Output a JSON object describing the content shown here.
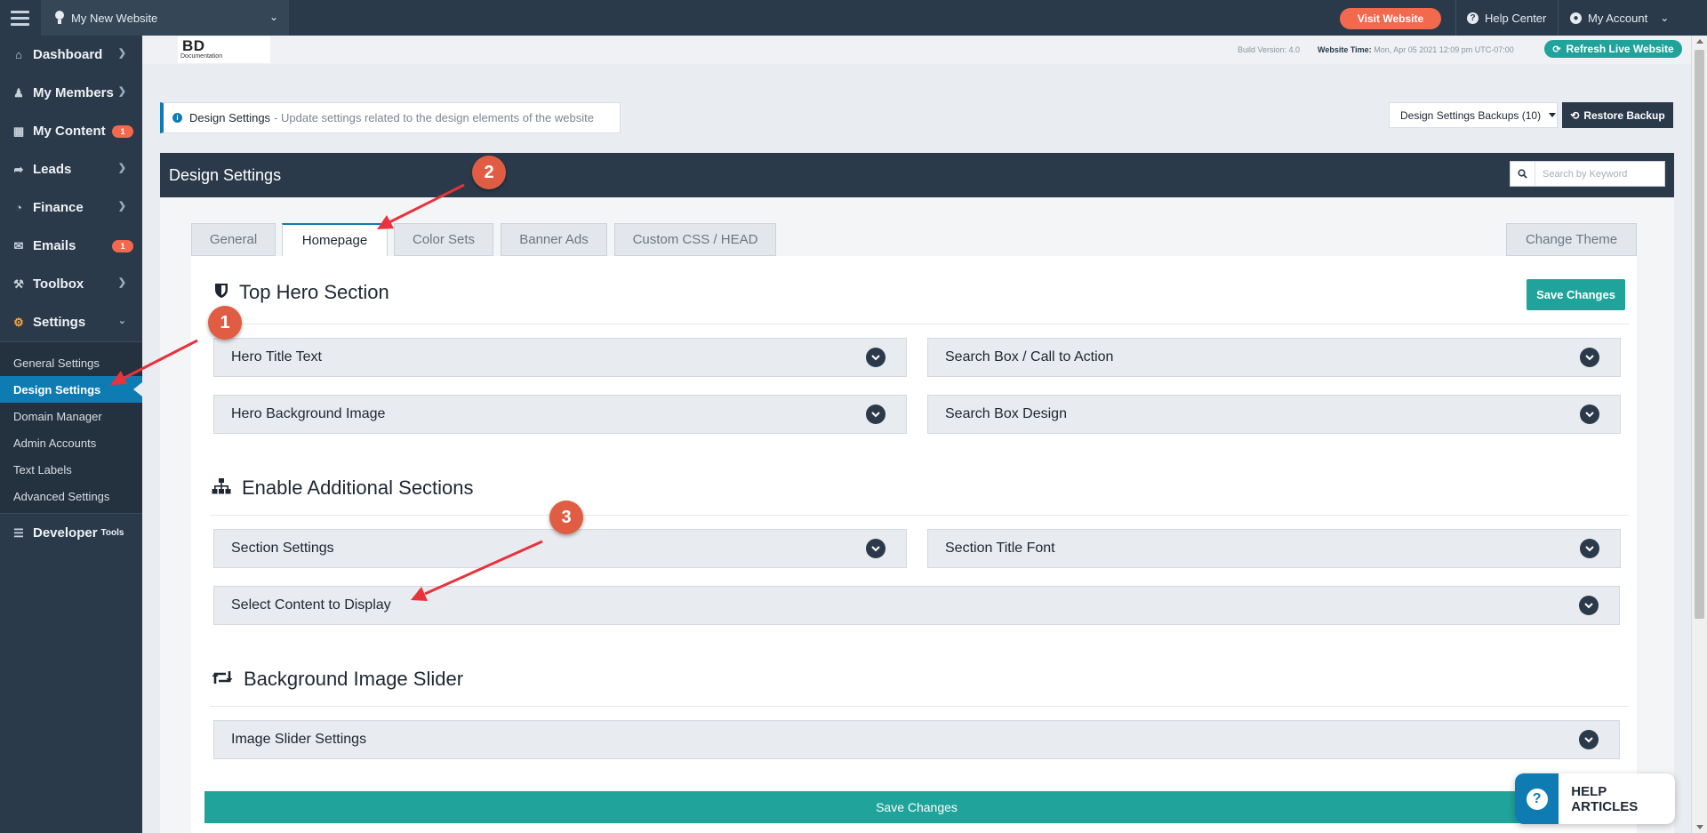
{
  "topbar": {
    "site_name": "My New Website",
    "visit_label": "Visit Website",
    "help_label": "Help Center",
    "account_label": "My Account"
  },
  "sidebar": {
    "items": [
      {
        "label": "Dashboard",
        "icon": "home-icon",
        "badge": ""
      },
      {
        "label": "My Members",
        "icon": "users-icon",
        "badge": ""
      },
      {
        "label": "My Content",
        "icon": "folder-icon",
        "badge": "1"
      },
      {
        "label": "Leads",
        "icon": "share-icon",
        "badge": ""
      },
      {
        "label": "Finance",
        "icon": "pie-chart-icon",
        "badge": ""
      },
      {
        "label": "Emails",
        "icon": "inbox-icon",
        "badge": "1"
      },
      {
        "label": "Toolbox",
        "icon": "wrench-icon",
        "badge": ""
      },
      {
        "label": "Settings",
        "icon": "gear-icon",
        "badge": ""
      }
    ],
    "sub_items": [
      {
        "label": "General Settings",
        "active": false
      },
      {
        "label": "Design Settings",
        "active": true
      },
      {
        "label": "Domain Manager",
        "active": false
      },
      {
        "label": "Admin Accounts",
        "active": false
      },
      {
        "label": "Text Labels",
        "active": false
      },
      {
        "label": "Advanced Settings",
        "active": false
      }
    ],
    "developer": {
      "label": "Developer",
      "small": "Tools",
      "icon": "sliders-icon"
    }
  },
  "header": {
    "logo_text": "BD",
    "logo_sub": "Documentation",
    "build_info": "Build Version: 4.0",
    "time_label": "Website Time:",
    "time_value": "Mon, Apr 05 2021 12:09 pm UTC-07:00",
    "refresh_label": "Refresh Live Website"
  },
  "info_bar": {
    "title": "Design Settings",
    "description": "- Update settings related to the design elements of the website"
  },
  "backups": {
    "dropdown_label": "Design Settings Backups (10)",
    "restore_label": "Restore Backup"
  },
  "panel": {
    "title": "Design Settings",
    "search_placeholder": "Search by Keyword"
  },
  "tabs": [
    {
      "label": "General",
      "active": false
    },
    {
      "label": "Homepage",
      "active": true
    },
    {
      "label": "Color Sets",
      "active": false
    },
    {
      "label": "Banner Ads",
      "active": false
    },
    {
      "label": "Custom CSS / HEAD",
      "active": false
    }
  ],
  "change_theme_label": "Change Theme",
  "sections": {
    "hero": {
      "title": "Top Hero Section",
      "save_label": "Save Changes",
      "items": [
        "Hero Title Text",
        "Search Box / Call to Action",
        "Hero Background Image",
        "Search Box Design"
      ]
    },
    "additional": {
      "title": "Enable Additional Sections",
      "items": [
        "Section Settings",
        "Section Title Font",
        "Select Content to Display"
      ]
    },
    "slider": {
      "title": "Background Image Slider",
      "items": [
        "Image Slider Settings"
      ]
    }
  },
  "save_bottom_label": "Save Changes",
  "annotations": [
    "1",
    "2",
    "3"
  ],
  "help_widget_label": "HELP ARTICLES",
  "colors": {
    "sidebar_bg": "#2b3a4a",
    "accent_blue": "#0e7bb3",
    "accent_teal": "#1fa39a",
    "accent_orange": "#f2694d",
    "annotation_red": "#e05d44"
  }
}
